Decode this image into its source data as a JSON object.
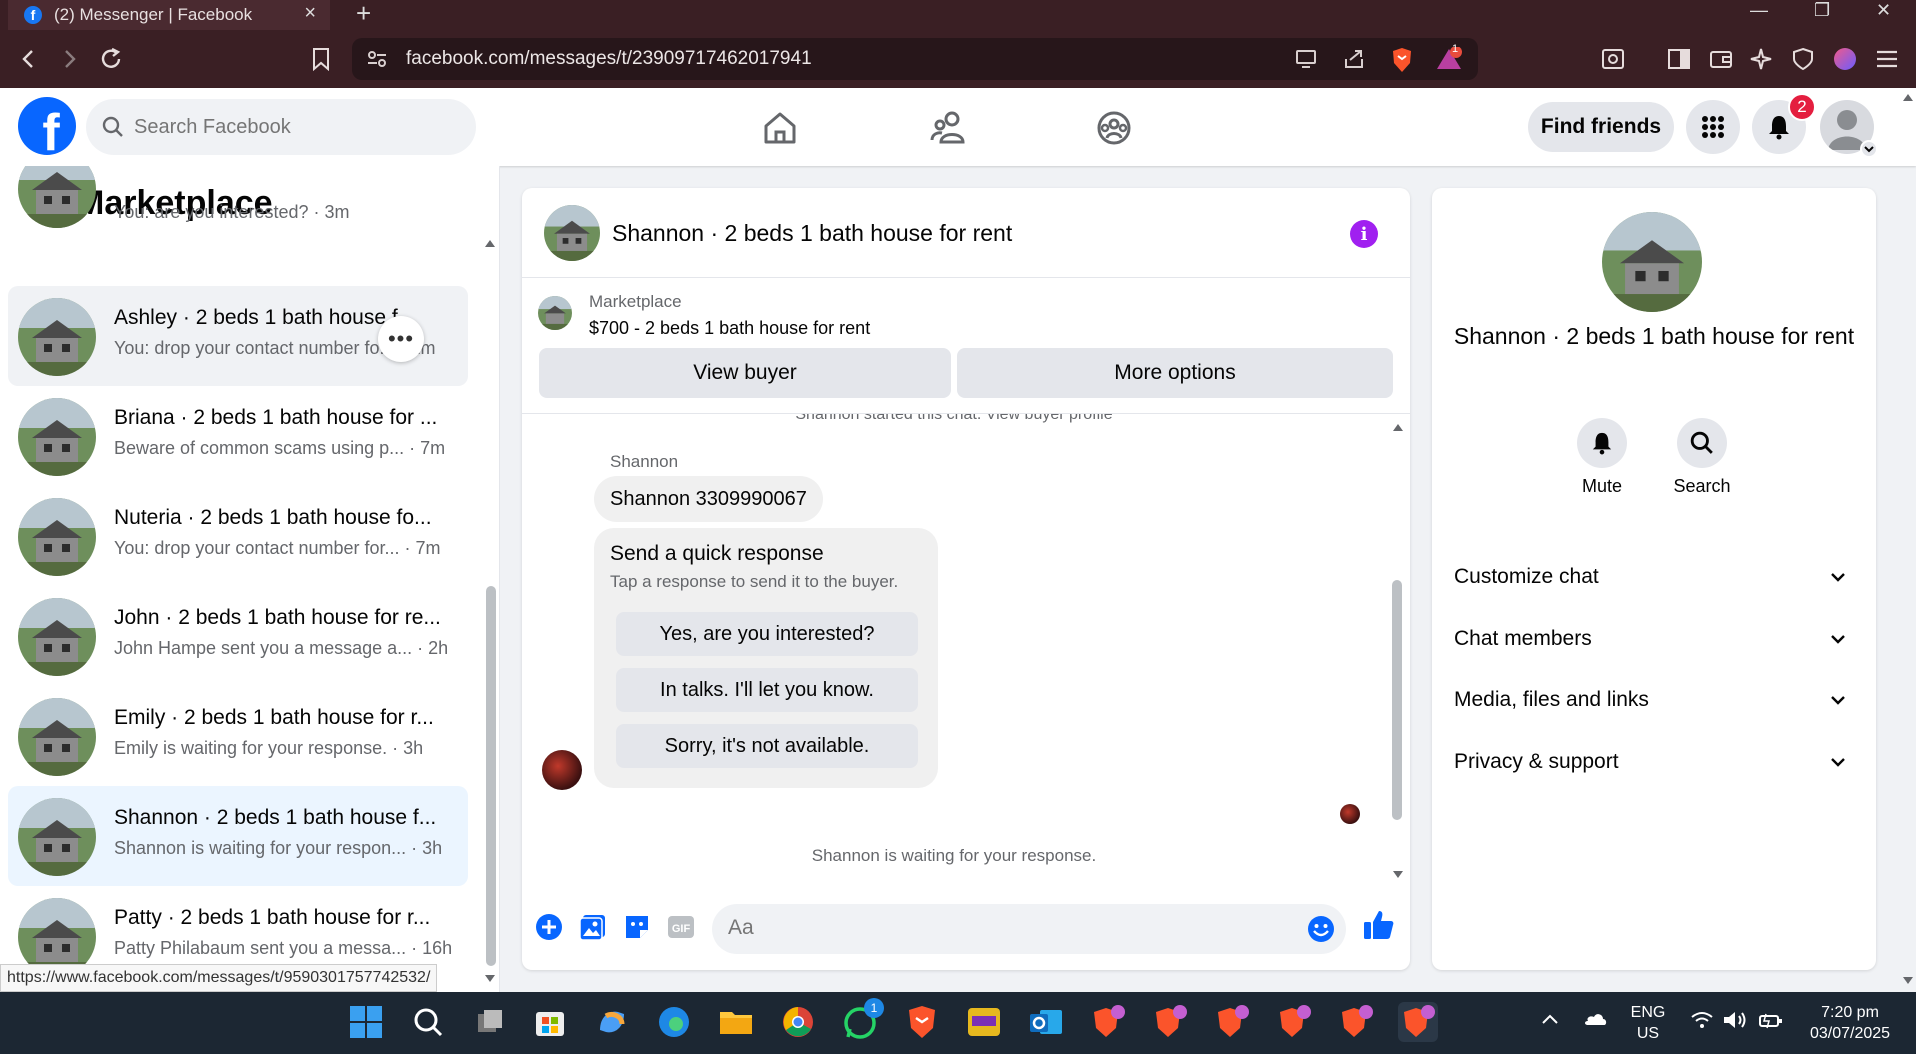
{
  "browser": {
    "tab_title": "(2) Messenger | Facebook",
    "url": "facebook.com/messages/t/23909717462017941",
    "brave_badge": "1"
  },
  "header": {
    "search_placeholder": "Search Facebook",
    "find_friends": "Find friends",
    "notification_count": "2"
  },
  "sidebar": {
    "title": "Marketplace",
    "partial_item_sub": "You: are you interested? · 3m",
    "conversations": [
      {
        "name": "Ashley · 2 beds 1 bath house f...",
        "sub": "You: drop your contact number fo... · 1m"
      },
      {
        "name": "Briana · 2 beds 1 bath house for ...",
        "sub": "Beware of common scams using p... · 7m"
      },
      {
        "name": "Nuteria · 2 beds 1 bath house fo...",
        "sub": "You: drop your contact number for... · 7m"
      },
      {
        "name": "John · 2 beds 1 bath house for re...",
        "sub": "John Hampe sent you a message a... · 2h"
      },
      {
        "name": "Emily · 2 beds 1 bath house for r...",
        "sub": "Emily is waiting for your response. · 3h"
      },
      {
        "name": "Shannon · 2 beds 1 bath house f...",
        "sub": "Shannon is waiting for your respon... · 3h"
      },
      {
        "name": "Patty · 2 beds 1 bath house for r...",
        "sub": "Patty Philabaum sent you a messa... · 16h"
      }
    ]
  },
  "chat": {
    "title": "Shannon · 2 beds 1 bath house for rent",
    "listing_source": "Marketplace",
    "listing_price": "$700 - 2 beds 1 bath house for rent",
    "view_buyer": "View buyer",
    "more_options": "More options",
    "start_note": "Shannon started this chat. View buyer profile",
    "sender": "Shannon",
    "message": "Shannon 3309990067",
    "quick_title": "Send a quick response",
    "quick_sub": "Tap a response to send it to the buyer.",
    "quick_options": [
      "Yes, are you interested?",
      "In talks. I'll let you know.",
      "Sorry, it's not available."
    ],
    "waiting": "Shannon is waiting for your response.",
    "composer_placeholder": "Aa"
  },
  "info_panel": {
    "name": "Shannon · 2 beds 1 bath house for rent",
    "mute": "Mute",
    "search": "Search",
    "sections": [
      "Customize chat",
      "Chat members",
      "Media, files and links",
      "Privacy & support"
    ]
  },
  "status_url": "https://www.facebook.com/messages/t/9590301757742532/",
  "taskbar": {
    "lang1": "ENG",
    "lang2": "US",
    "time": "7:20 pm",
    "date": "03/07/2025",
    "whatsapp_badge": "1"
  }
}
